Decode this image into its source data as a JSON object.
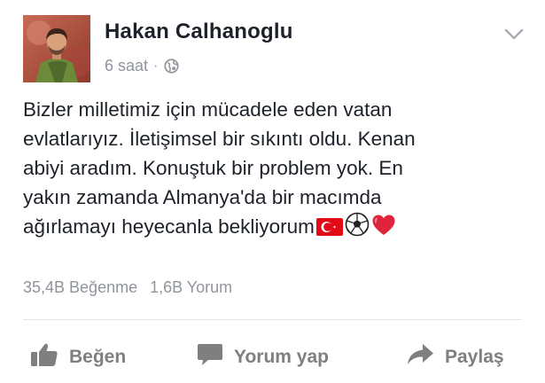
{
  "post": {
    "author": "Hakan Calhanoglu",
    "time": "6 saat",
    "dot": "·",
    "privacy_icon": "globe-icon",
    "menu_icon": "chevron-down-icon",
    "text_lines": [
      "Bizler milletimiz için mücadele eden vatan",
      "evlatlarıyız. İletişimsel bir sıkıntı oldu. Kenan",
      "abiyi aradım. Konuştuk bir problem yok. En",
      "yakın zamanda Almanya'da bir macımda",
      "ağırlamayı heyecanla bekliyorum"
    ],
    "emojis": [
      "turkish-flag-icon",
      "soccer-ball-icon",
      "red-heart-icon"
    ]
  },
  "stats": {
    "likes": "35,4B Beğenme",
    "comments": "1,6B Yorum"
  },
  "actions": {
    "like_label": "Beğen",
    "comment_label": "Yorum yap",
    "share_label": "Paylaş"
  },
  "colors": {
    "text": "#1d2129",
    "muted": "#90949c",
    "action": "#7f7f7f",
    "flag_red": "#e30a17",
    "heart_red": "#e0243b"
  }
}
